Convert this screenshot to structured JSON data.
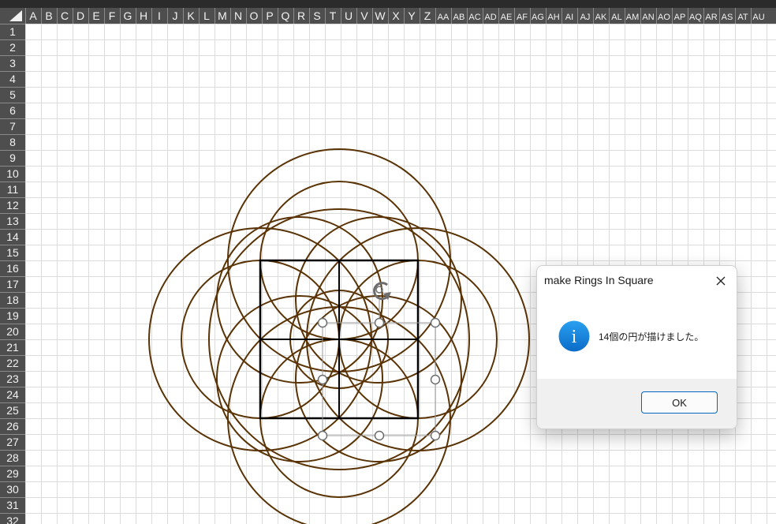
{
  "sheet": {
    "columns": [
      "A",
      "B",
      "C",
      "D",
      "E",
      "F",
      "G",
      "H",
      "I",
      "J",
      "K",
      "L",
      "M",
      "N",
      "O",
      "P",
      "Q",
      "R",
      "S",
      "T",
      "U",
      "V",
      "W",
      "X",
      "Y",
      "Z",
      "AA",
      "AB",
      "AC",
      "AD",
      "AE",
      "AF",
      "AG",
      "AH",
      "AI",
      "AJ",
      "AK",
      "AL",
      "AM",
      "AN",
      "AO",
      "AP",
      "AQ",
      "AR",
      "AS",
      "AT",
      "AU"
    ],
    "rows": [
      "1",
      "2",
      "3",
      "4",
      "5",
      "6",
      "7",
      "8",
      "9",
      "10",
      "11",
      "12",
      "13",
      "14",
      "15",
      "16",
      "17",
      "18",
      "19",
      "20",
      "21",
      "22",
      "23",
      "24",
      "25",
      "26",
      "27",
      "28",
      "29",
      "30",
      "31",
      "32"
    ]
  },
  "drawing": {
    "ring_color": "#5a3305",
    "square_color": "#000000"
  },
  "dialog": {
    "title": "make Rings In Square",
    "message": "14個の円が描けました。",
    "ok_label": "OK",
    "close_icon": "close-icon",
    "info_icon": "info-icon",
    "info_glyph": "i"
  }
}
